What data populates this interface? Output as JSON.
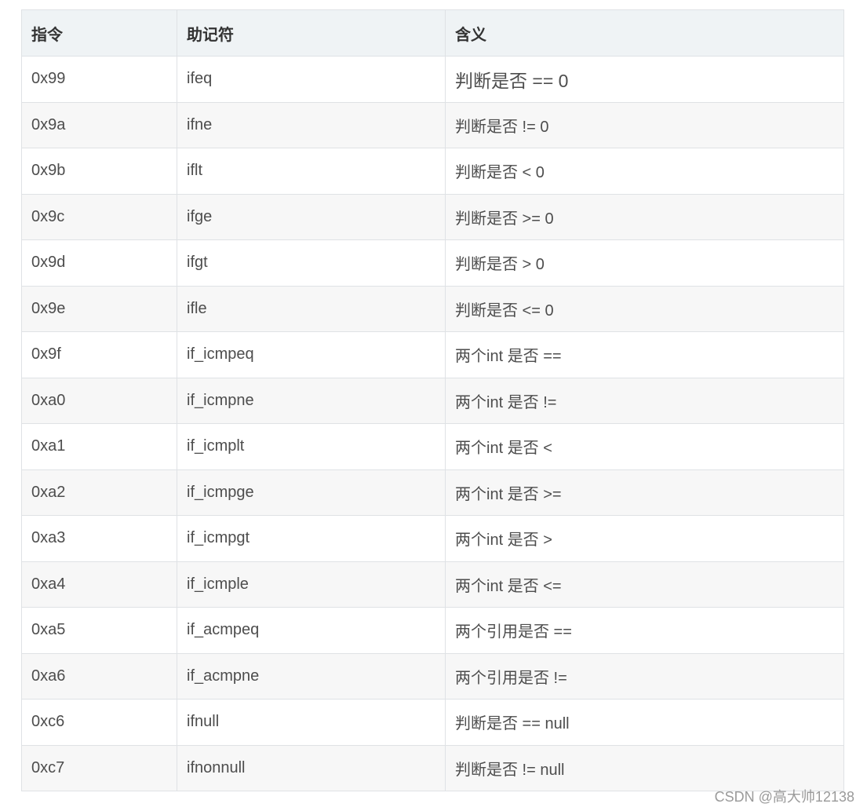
{
  "table": {
    "headers": [
      "指令",
      "助记符",
      "含义"
    ],
    "rows": [
      [
        "0x99",
        "ifeq",
        "判断是否 == 0"
      ],
      [
        "0x9a",
        "ifne",
        "判断是否 != 0"
      ],
      [
        "0x9b",
        "iflt",
        "判断是否 < 0"
      ],
      [
        "0x9c",
        "ifge",
        "判断是否 >= 0"
      ],
      [
        "0x9d",
        "ifgt",
        "判断是否 > 0"
      ],
      [
        "0x9e",
        "ifle",
        "判断是否 <= 0"
      ],
      [
        "0x9f",
        "if_icmpeq",
        "两个int 是否 =="
      ],
      [
        "0xa0",
        "if_icmpne",
        "两个int 是否 !="
      ],
      [
        "0xa1",
        "if_icmplt",
        "两个int 是否 <"
      ],
      [
        "0xa2",
        "if_icmpge",
        "两个int 是否 >="
      ],
      [
        "0xa3",
        "if_icmpgt",
        "两个int 是否 >"
      ],
      [
        "0xa4",
        "if_icmple",
        "两个int 是否 <="
      ],
      [
        "0xa5",
        "if_acmpeq",
        "两个引用是否 =="
      ],
      [
        "0xa6",
        "if_acmpne",
        "两个引用是否 !="
      ],
      [
        "0xc6",
        "ifnull",
        "判断是否 == null"
      ],
      [
        "0xc7",
        "ifnonnull",
        "判断是否 != null"
      ]
    ]
  },
  "watermark": "CSDN @高大帅12138"
}
